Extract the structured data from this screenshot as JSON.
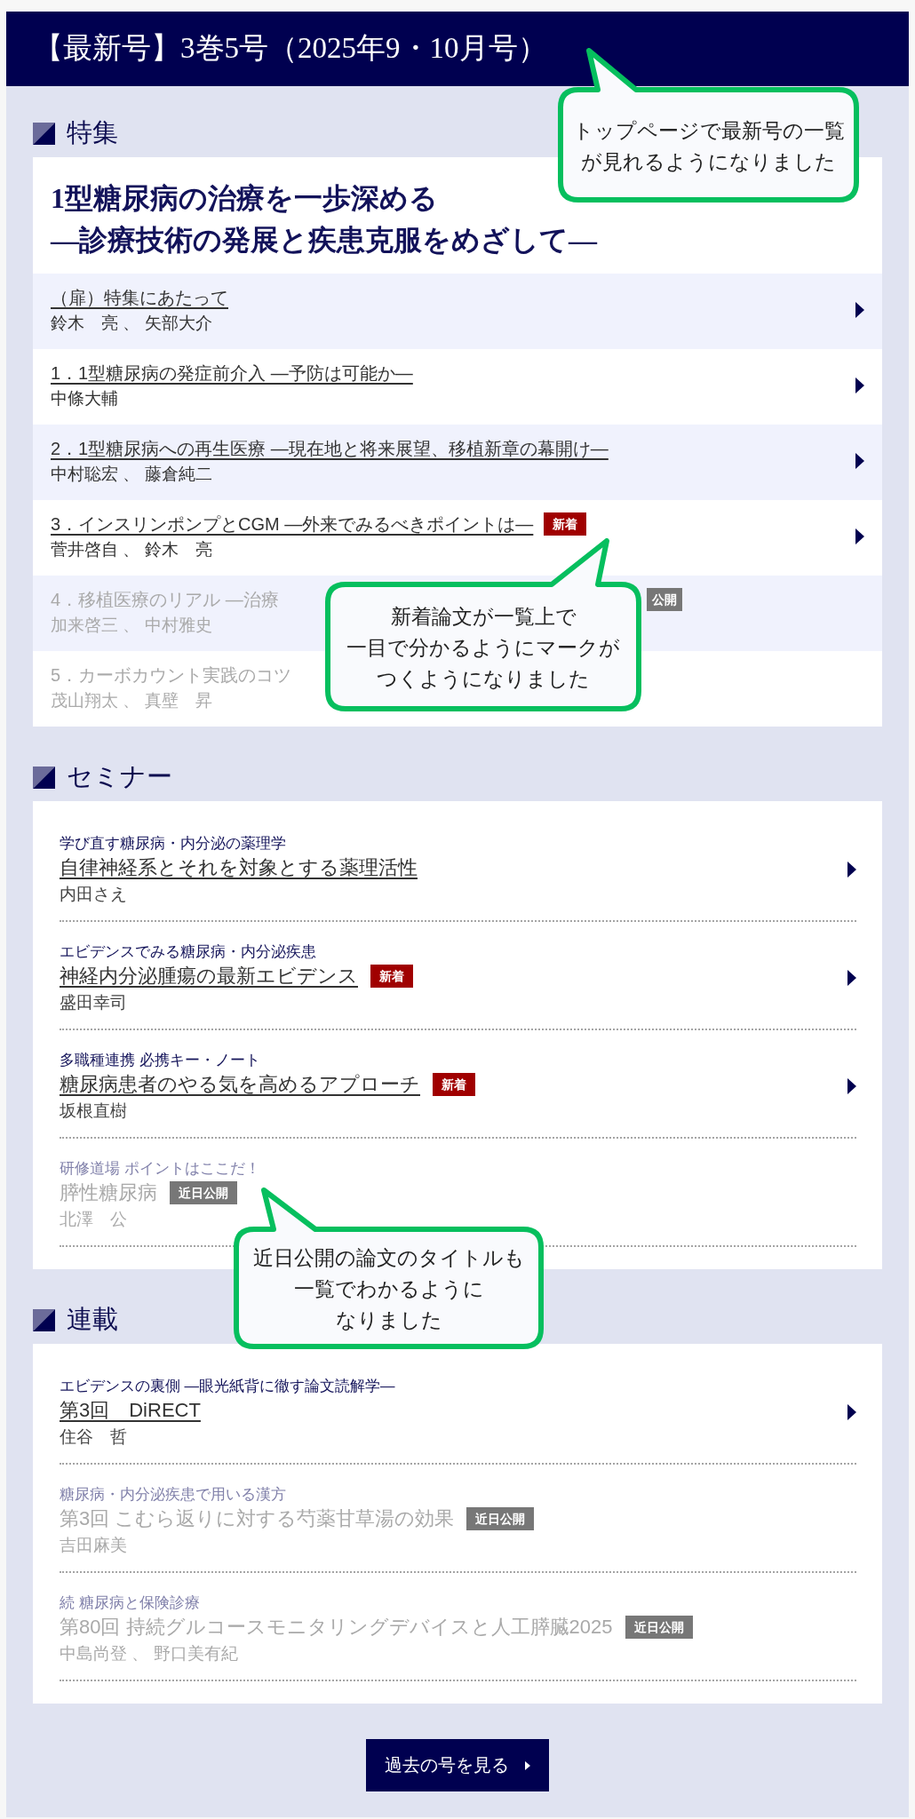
{
  "header": {
    "title": "【最新号】3巻5号（2025年9・10月号）"
  },
  "sections": [
    {
      "kind": "feature",
      "heading": "特集",
      "feature_title": "1型糖尿病の治療を一歩深める",
      "feature_subtitle": "―診療技術の発展と疾患克服をめざして―",
      "articles": [
        {
          "title": "（扉）特集にあたって",
          "authors": "鈴木　亮 、 矢部大介",
          "published": true
        },
        {
          "title": "1．1型糖尿病の発症前介入 ―予防は可能か―",
          "authors": "中條大輔",
          "published": true
        },
        {
          "title": "2．1型糖尿病への再生医療 ―現在地と将来展望、移植新章の幕開け―",
          "authors": "中村聡宏 、 藤倉純二",
          "published": true
        },
        {
          "title": "3．インスリンポンプとCGM ―外来でみるべきポイントは―",
          "authors": "菅井啓自 、 鈴木　亮",
          "published": true,
          "badge": {
            "kind": "new",
            "label": "新着"
          }
        },
        {
          "title": "4．移植医療のリアル ―治療",
          "authors": "加来啓三 、 中村雅史",
          "published": false,
          "badge": {
            "kind": "soon",
            "label": "公開"
          }
        },
        {
          "title": "5．カーボカウント実践のコツ",
          "authors": "茂山翔太 、 真壁　昇",
          "published": false
        }
      ]
    },
    {
      "kind": "series",
      "heading": "セミナー",
      "articles": [
        {
          "series": "学び直す糖尿病・内分泌の薬理学",
          "title": "自律神経系とそれを対象とする薬理活性",
          "authors": "内田さえ",
          "published": true
        },
        {
          "series": "エビデンスでみる糖尿病・内分泌疾患",
          "title": "神経内分泌腫瘍の最新エビデンス",
          "authors": "盛田幸司",
          "published": true,
          "badge": {
            "kind": "new",
            "label": "新着"
          }
        },
        {
          "series": "多職種連携 必携キー・ノート",
          "title": "糖尿病患者のやる気を高めるアプローチ",
          "authors": "坂根直樹",
          "published": true,
          "badge": {
            "kind": "new",
            "label": "新着"
          }
        },
        {
          "series": "研修道場 ポイントはここだ！",
          "title": "膵性糖尿病",
          "authors": "北澤　公",
          "published": false,
          "badge": {
            "kind": "soon",
            "label": "近日公開"
          }
        }
      ]
    },
    {
      "kind": "series",
      "heading": "連載",
      "articles": [
        {
          "series": "エビデンスの裏側 ―眼光紙背に徹す論文読解学―",
          "title": "第3回　DiRECT",
          "authors": "住谷　哲",
          "published": true
        },
        {
          "series": "糖尿病・内分泌疾患で用いる漢方",
          "title": "第3回 こむら返りに対する芍薬甘草湯の効果",
          "authors": "吉田麻美",
          "published": false,
          "badge": {
            "kind": "soon",
            "label": "近日公開"
          }
        },
        {
          "series": "続 糖尿病と保険診療",
          "title": "第80回 持続グルコースモニタリングデバイスと人工膵臓2025",
          "authors": "中島尚登 、 野口美有紀",
          "published": false,
          "badge": {
            "kind": "soon",
            "label": "近日公開"
          }
        }
      ]
    }
  ],
  "past_issues_button": {
    "label": "過去の号を見る"
  },
  "callouts": [
    {
      "lines": [
        "トップページで最新号の一覧",
        "が見れるようになりました"
      ]
    },
    {
      "lines": [
        "新着論文が一覧上で",
        "一目で分かるようにマークが",
        "つくようになりました"
      ]
    },
    {
      "lines": [
        "近日公開の論文のタイトルも",
        "一覧でわかるように",
        "なりました"
      ]
    }
  ]
}
